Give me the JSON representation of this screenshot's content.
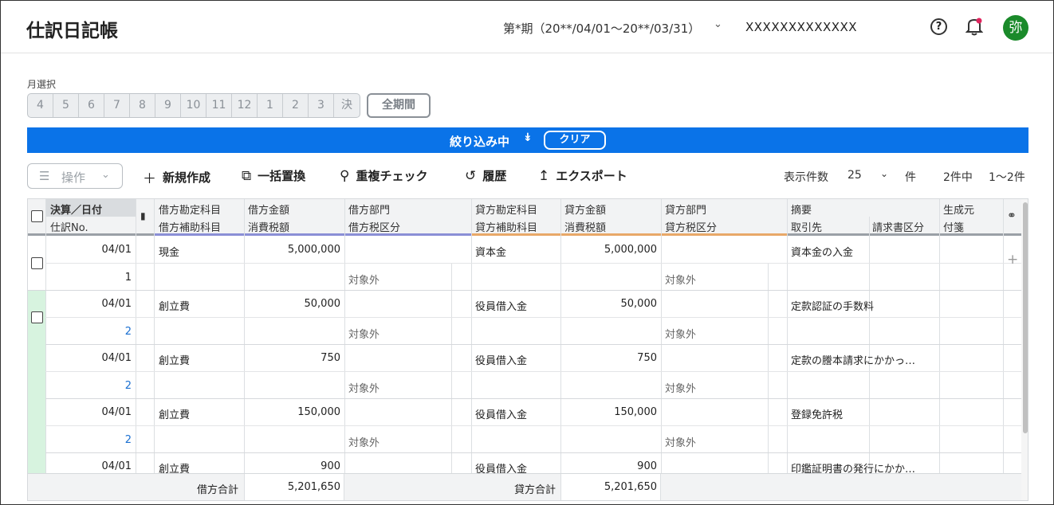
{
  "header": {
    "title": "仕訳日記帳",
    "period": "第*期（20**/04/01〜20**/03/31）",
    "company": "XXXXXXXXXXXXX",
    "avatar": "弥"
  },
  "months": {
    "label": "月選択",
    "items": [
      "4",
      "5",
      "6",
      "7",
      "8",
      "9",
      "10",
      "11",
      "12",
      "1",
      "2",
      "3",
      "決"
    ],
    "all_label": "全期間"
  },
  "filter": {
    "text": "絞り込み中",
    "clear": "クリア"
  },
  "toolbar": {
    "operation": "操作",
    "new": "新規作成",
    "bulk_replace": "一括置換",
    "dup_check": "重複チェック",
    "history": "履歴",
    "export": "エクスポート",
    "per_page_label": "表示件数",
    "per_page_value": "25",
    "per_page_unit": "件",
    "count": "2件中",
    "range": "1〜2件"
  },
  "columns": {
    "settle_date": "決算／日付",
    "journal_no": "仕訳No.",
    "debit_account": "借方勘定科目",
    "debit_sub": "借方補助科目",
    "debit_amount": "借方金額",
    "debit_tax": "消費税額",
    "debit_dept": "借方部門",
    "debit_tax_class": "借方税区分",
    "credit_account": "貸方勘定科目",
    "credit_sub": "貸方補助科目",
    "credit_amount": "貸方金額",
    "credit_tax": "消費税額",
    "credit_dept": "貸方部門",
    "credit_tax_class": "貸方税区分",
    "summary": "摘要",
    "partner": "取引先",
    "invoice_class": "請求書区分",
    "source": "生成元",
    "sticky": "付箋"
  },
  "rows": [
    {
      "date": "04/01",
      "no": "1",
      "debit_account": "現金",
      "debit_amount": "5,000,000",
      "debit_tax_class": "対象外",
      "credit_account": "資本金",
      "credit_amount": "5,000,000",
      "credit_tax_class": "対象外",
      "summary": "資本金の入金"
    },
    {
      "date": "04/01",
      "no": "2",
      "debit_account": "創立費",
      "debit_amount": "50,000",
      "debit_tax_class": "対象外",
      "credit_account": "役員借入金",
      "credit_amount": "50,000",
      "credit_tax_class": "対象外",
      "summary": "定款認証の手数料"
    },
    {
      "date": "04/01",
      "no": "2",
      "debit_account": "創立費",
      "debit_amount": "750",
      "debit_tax_class": "対象外",
      "credit_account": "役員借入金",
      "credit_amount": "750",
      "credit_tax_class": "対象外",
      "summary": "定款の謄本請求にかかっ…"
    },
    {
      "date": "04/01",
      "no": "2",
      "debit_account": "創立費",
      "debit_amount": "150,000",
      "debit_tax_class": "対象外",
      "credit_account": "役員借入金",
      "credit_amount": "150,000",
      "credit_tax_class": "対象外",
      "summary": "登録免許税"
    },
    {
      "date": "04/01",
      "no": "",
      "debit_account": "創立費",
      "debit_amount": "900",
      "debit_tax_class": "",
      "credit_account": "役員借入金",
      "credit_amount": "900",
      "credit_tax_class": "",
      "summary": "印鑑証明書の発行にかか…"
    }
  ],
  "footer": {
    "debit_total_label": "借方合計",
    "debit_total": "5,201,650",
    "credit_total_label": "貸方合計",
    "credit_total": "5,201,650"
  },
  "colors": {
    "accent": "#0a73e8",
    "avatar": "#1a8a2a",
    "debit_bar": "#8a8fd6",
    "credit_bar": "#e8a868",
    "neutral_bar": "#9aa0a6",
    "row_highlight": "#d7f3df"
  },
  "icons": [
    "help-icon",
    "bell-icon",
    "hamburger-icon",
    "plus-icon",
    "bulk-replace-icon",
    "duplicate-check-icon",
    "history-icon",
    "export-icon",
    "paperclip-icon",
    "chevron-down-icon"
  ]
}
